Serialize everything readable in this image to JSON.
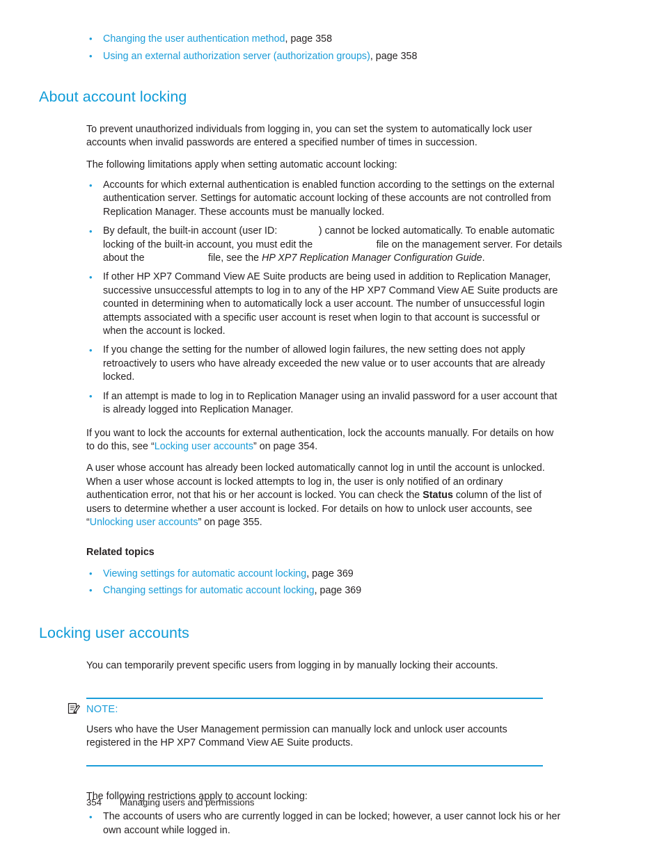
{
  "colors": {
    "link": "#1b9dd9",
    "heading": "#0f9bd7",
    "text": "#231f20",
    "rule": "#1b9dd9"
  },
  "top_links": [
    {
      "text": "Changing the user authentication method",
      "suffix": ", page 358"
    },
    {
      "text": "Using an external authorization server (authorization groups)",
      "suffix": ", page 358"
    }
  ],
  "section_one": {
    "heading": "About account locking",
    "intro": "To prevent unauthorized individuals from logging in, you can set the system to automatically lock user accounts when invalid passwords are entered a specified number of times in succession.",
    "limitations_lead": "The following limitations apply when setting automatic account locking:",
    "bullets": {
      "b1": "Accounts for which external authentication is enabled function according to the settings on the external authentication server. Settings for automatic account locking of these accounts are not controlled from Replication Manager. These accounts must be manually locked.",
      "b2_part1": "By default, the built-in account (user ID:",
      "b2_part2": ") cannot be locked automatically. To enable automatic locking of the built-in account, you must edit the",
      "b2_part3": "file on the management server. For details about the",
      "b2_part4": "file, see the",
      "b2_guide": "HP XP7 Replication Manager Configuration Guide",
      "b2_part5": ".",
      "b3": "If other HP XP7 Command View AE Suite products are being used in addition to Replication Manager, successive unsuccessful attempts to log in to any of the HP XP7 Command View AE Suite products are counted in determining when to automatically lock a user account. The number of unsuccessful login attempts associated with a specific user account is reset when login to that account is successful or when the account is locked.",
      "b4": "If you change the setting for the number of allowed login failures, the new setting does not apply retroactively to users who have already exceeded the new value or to user accounts that are already locked.",
      "b5": "If an attempt is made to log in to Replication Manager using an invalid password for a user account that is already logged into Replication Manager."
    },
    "para_external_part1": "If you want to lock the accounts for external authentication, lock the accounts manually. For details on how to do this, see “",
    "para_external_link": "Locking user accounts",
    "para_external_part2": "” on page 354.",
    "para_locked_part1": "A user whose account has already been locked automatically cannot log in until the account is unlocked. When a user whose account is locked attempts to log in, the user is only notified of an ordinary authentication error, not that his or her account is locked.  You can check the ",
    "para_locked_bold": "Status",
    "para_locked_part2": " column of the list of users to determine whether a user account is locked. For details on how to unlock user accounts, see “",
    "para_locked_link": "Unlocking user accounts",
    "para_locked_part3": "” on page 355.",
    "related_title": "Related topics",
    "related_links": [
      {
        "text": "Viewing settings for automatic account locking",
        "suffix": ", page 369"
      },
      {
        "text": "Changing settings for automatic account locking",
        "suffix": ", page 369"
      }
    ]
  },
  "section_two": {
    "heading": "Locking user accounts",
    "intro": "You can temporarily prevent specific users from logging in by manually locking their accounts.",
    "note": {
      "icon": "note-pencil-icon",
      "label": "NOTE:",
      "body": "Users who have the User Management permission can manually lock and unlock user accounts registered in the HP XP7 Command View AE Suite products."
    },
    "restrictions_lead": "The following restrictions apply to account locking:",
    "restriction_bullets": [
      "The accounts of users who are currently logged in can be locked; however, a user cannot lock his or her own account while logged in."
    ]
  },
  "footer": {
    "page_number": "354",
    "chapter": "Managing users and permissions"
  }
}
